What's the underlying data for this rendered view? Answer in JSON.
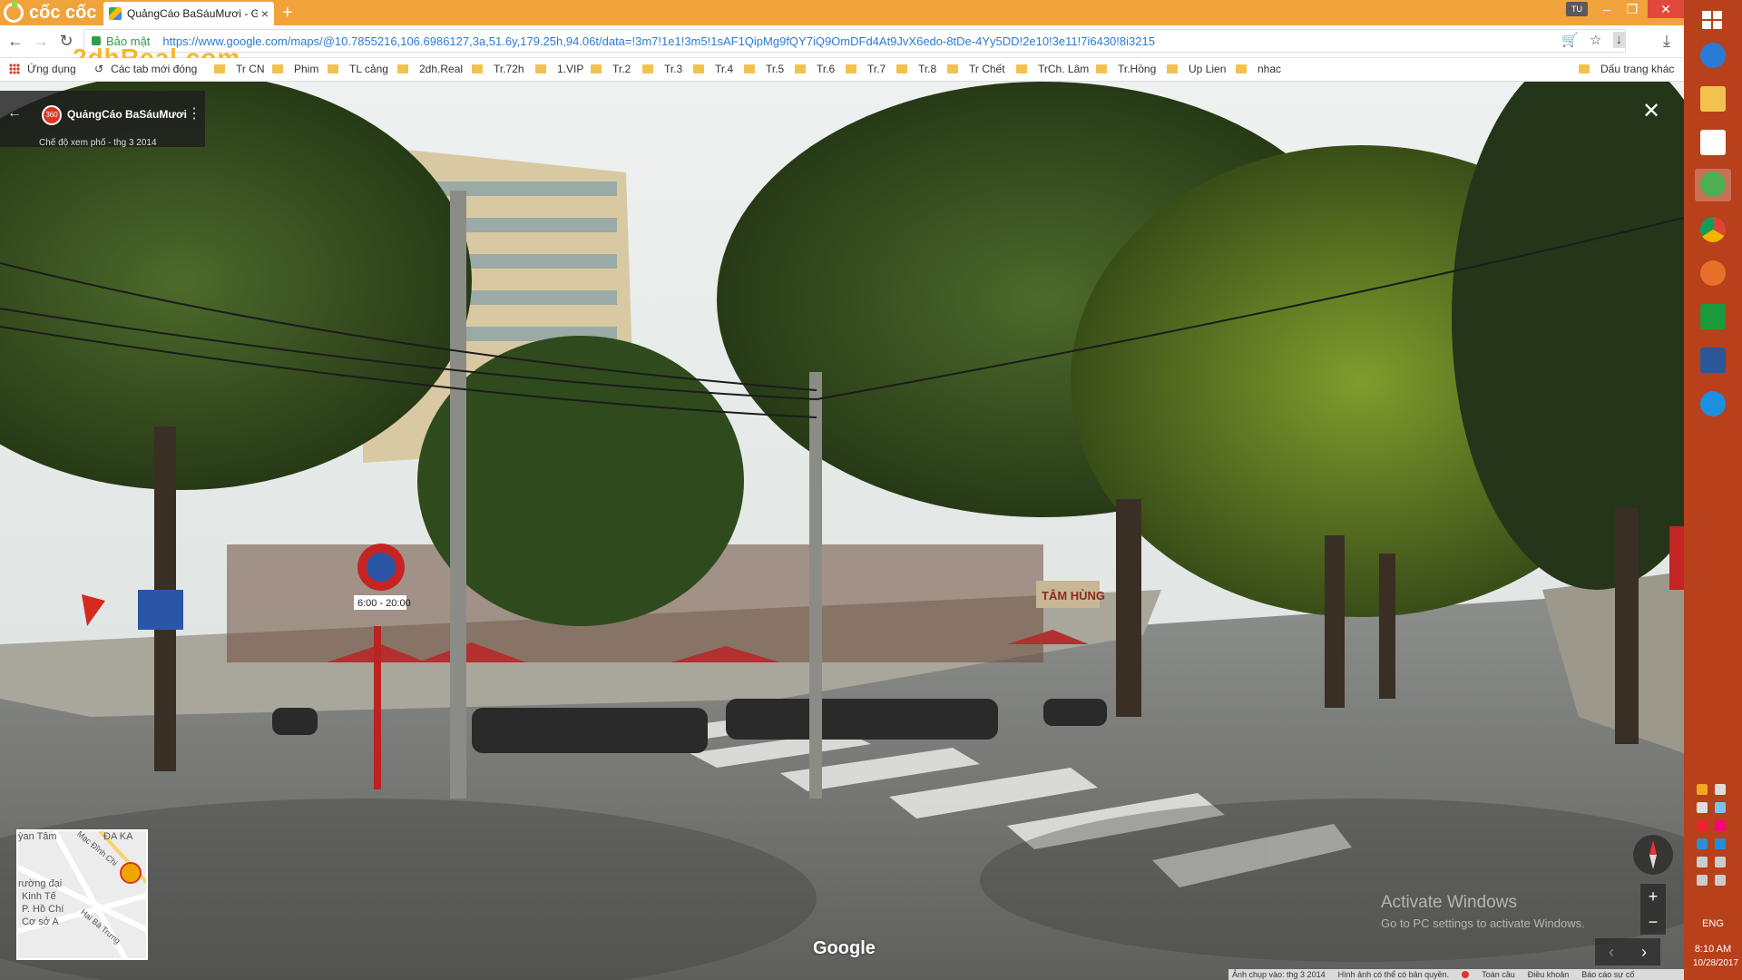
{
  "browser": {
    "brand": "cốc cốc",
    "tab_title": "QuảngCáo BaSáuMươi - G",
    "tab_close": "×",
    "new_tab": "+",
    "user_badge": "TU",
    "secure_label": "Bảo mật",
    "url": "https://www.google.com/maps/@10.7855216,106.6986127,3a,51.6y,179.25h,94.06t/data=!3m7!1e1!3m5!1sAF1QipMg9fQY7iQ9OmDFd4At9JvX6edo-8tDe-4Yy5DD!2e10!3e11!7i6430!8i3215",
    "watermark": "2dhReal.com",
    "window_min": "–",
    "window_max": "❐",
    "window_close": "✕"
  },
  "bookmarks": {
    "apps": "Ứng dụng",
    "recent_tabs": "Các tab mới đóng",
    "items": [
      "Tr CN",
      "Phim",
      "TL cảng",
      "2dh.Real",
      "Tr.72h",
      "1.VIP",
      "Tr.2",
      "Tr.3",
      "Tr.4",
      "Tr.5",
      "Tr.6",
      "Tr.7",
      "Tr.8",
      "Tr Chết",
      "TrCh. Lâm",
      "Tr.Hồng",
      "Up Lien",
      "nhac"
    ],
    "other": "Dấu trang khác"
  },
  "streetview": {
    "place_name": "QuảngCáo BaSáuMươi",
    "place_badge": "360",
    "place_subtitle": "Chế độ xem phố - thg 3 2014",
    "google_logo": "Google",
    "activate_title": "Activate Windows",
    "activate_sub": "Go to PC settings to activate Windows.",
    "sign_hours": "6:00 - 20:00",
    "shop_sign": "TÂM HÙNG",
    "minimap_labels": [
      "ỳan Tâm",
      "ĐA KA",
      "Mạc Đĩnh Chi",
      "rường đại",
      "Kinh Tế",
      "P. Hồ Chí",
      "Cơ sở A",
      "Hai Bà Trưng"
    ],
    "zoom_in": "+",
    "zoom_out": "−",
    "prev": "‹",
    "next": "›"
  },
  "footer": {
    "capture_date": "Ảnh chụp vào: thg 3 2014",
    "copyright": "Hình ảnh có thể có bản quyền.",
    "global": "Toàn cầu",
    "terms": "Điều khoản",
    "report": "Báo cáo sự cố"
  },
  "taskbar": {
    "language": "ENG",
    "time": "8:10 AM",
    "date": "10/28/2017"
  }
}
